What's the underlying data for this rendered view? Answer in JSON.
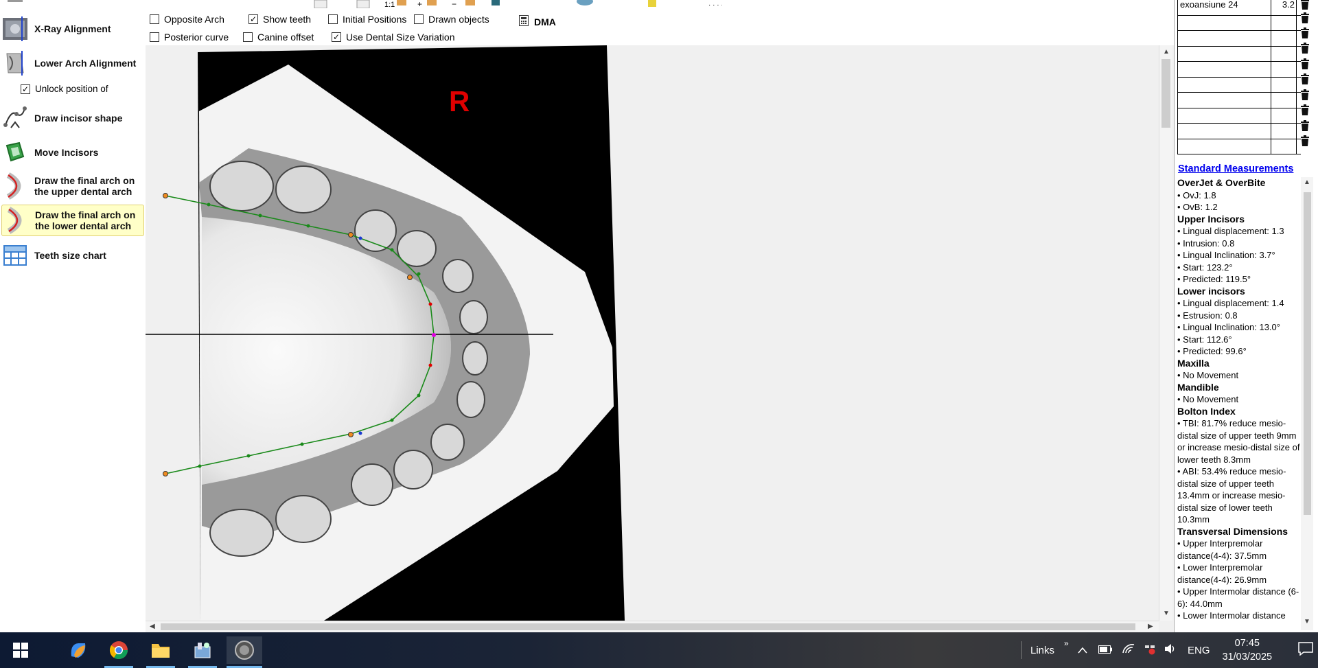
{
  "sidebar": {
    "tools": [
      {
        "label": "X-Ray Alignment"
      },
      {
        "label": "Lower Arch Alignment"
      },
      {
        "label": "Draw incisor shape"
      },
      {
        "label": "Move Incisors"
      },
      {
        "label": "Draw the final arch on the upper dental arch"
      },
      {
        "label": "Draw the final arch on the lower dental arch"
      },
      {
        "label": "Teeth size chart"
      }
    ],
    "unlock_label": "Unlock position of",
    "active_tool_index": 5
  },
  "options": {
    "opposite_arch": "Opposite Arch",
    "show_teeth": "Show teeth",
    "initial_positions": "Initial Positions",
    "drawn_objects": "Drawn objects",
    "dma": "DMA",
    "posterior_curve": "Posterior curve",
    "canine_offset": "Canine offset",
    "dental_size_variation": "Use Dental Size Variation",
    "zoom_1to1": "1:1"
  },
  "viewport": {
    "side_marker": "R"
  },
  "table": {
    "first_row_label": "exoansiune 24",
    "first_row_value": "3.2"
  },
  "measurements": {
    "link": "Standard Measurements",
    "sections": [
      {
        "title": "OverJet & OverBite",
        "items": [
          "• OvJ: 1.8",
          "• OvB: 1.2"
        ]
      },
      {
        "title": "Upper Incisors",
        "items": [
          "• Lingual displacement: 1.3",
          "• Intrusion: 0.8",
          "• Lingual Inclination: 3.7°",
          "• Start: 123.2°",
          "• Predicted: 119.5°"
        ]
      },
      {
        "title": "Lower incisors",
        "items": [
          "• Lingual displacement: 1.4",
          "• Estrusion: 0.8",
          "• Lingual Inclination: 13.0°",
          "• Start: 112.6°",
          "• Predicted: 99.6°"
        ]
      },
      {
        "title": "Maxilla",
        "items": [
          "• No Movement"
        ]
      },
      {
        "title": "Mandible",
        "items": [
          "• No Movement"
        ]
      },
      {
        "title": "Bolton Index",
        "items": [
          "• TBI: 81.7% reduce mesio-distal size of upper teeth 9mm or increase mesio-distal size of lower teeth 8.3mm",
          "• ABI: 53.4% reduce mesio-distal size of upper teeth 13.4mm or increase mesio-distal size of lower teeth 10.3mm"
        ]
      },
      {
        "title": "Transversal Dimensions",
        "items": [
          "• Upper  Interpremolar distance(4-4): 37.5mm",
          "• Lower  Interpremolar distance(4-4): 26.9mm",
          "• Upper Intermolar distance (6-6): 44.0mm",
          "• Lower  Intermolar distance"
        ]
      }
    ]
  },
  "taskbar": {
    "links_label": "Links",
    "language": "ENG",
    "time": "07:45",
    "date": "31/03/2025"
  },
  "colors": {
    "arch_line": "#1a8a1a",
    "active_tool_bg": "#ffffc8",
    "link_blue": "#0000ee",
    "marker_red": "#e00000"
  }
}
